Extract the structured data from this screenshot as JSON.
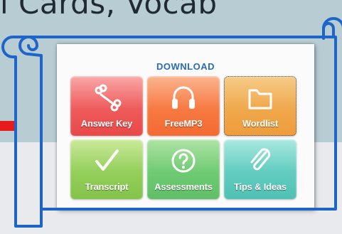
{
  "banner": {
    "text": "l Cards, Vocab"
  },
  "download": {
    "title": "DOWNLOAD",
    "tiles": [
      {
        "label": "Answer Key",
        "icon": "bone-icon",
        "color": "#ef5b5b"
      },
      {
        "label": "FreeMP3",
        "icon": "headphones-icon",
        "color": "#f77a43"
      },
      {
        "label": "Wordlist",
        "icon": "folder-icon",
        "color": "#f0a84c"
      },
      {
        "label": "Transcript",
        "icon": "checkmark-icon",
        "color": "#93cf5a"
      },
      {
        "label": "Assessments",
        "icon": "question-icon",
        "color": "#6fcb73"
      },
      {
        "label": "Tips & Ideas",
        "icon": "paperclip-icon",
        "color": "#62ccbf"
      }
    ]
  },
  "colors": {
    "scroll_outline": "#1f64c8",
    "banner_bg": "#b7cdd3",
    "accent_red": "#e81b1b"
  }
}
